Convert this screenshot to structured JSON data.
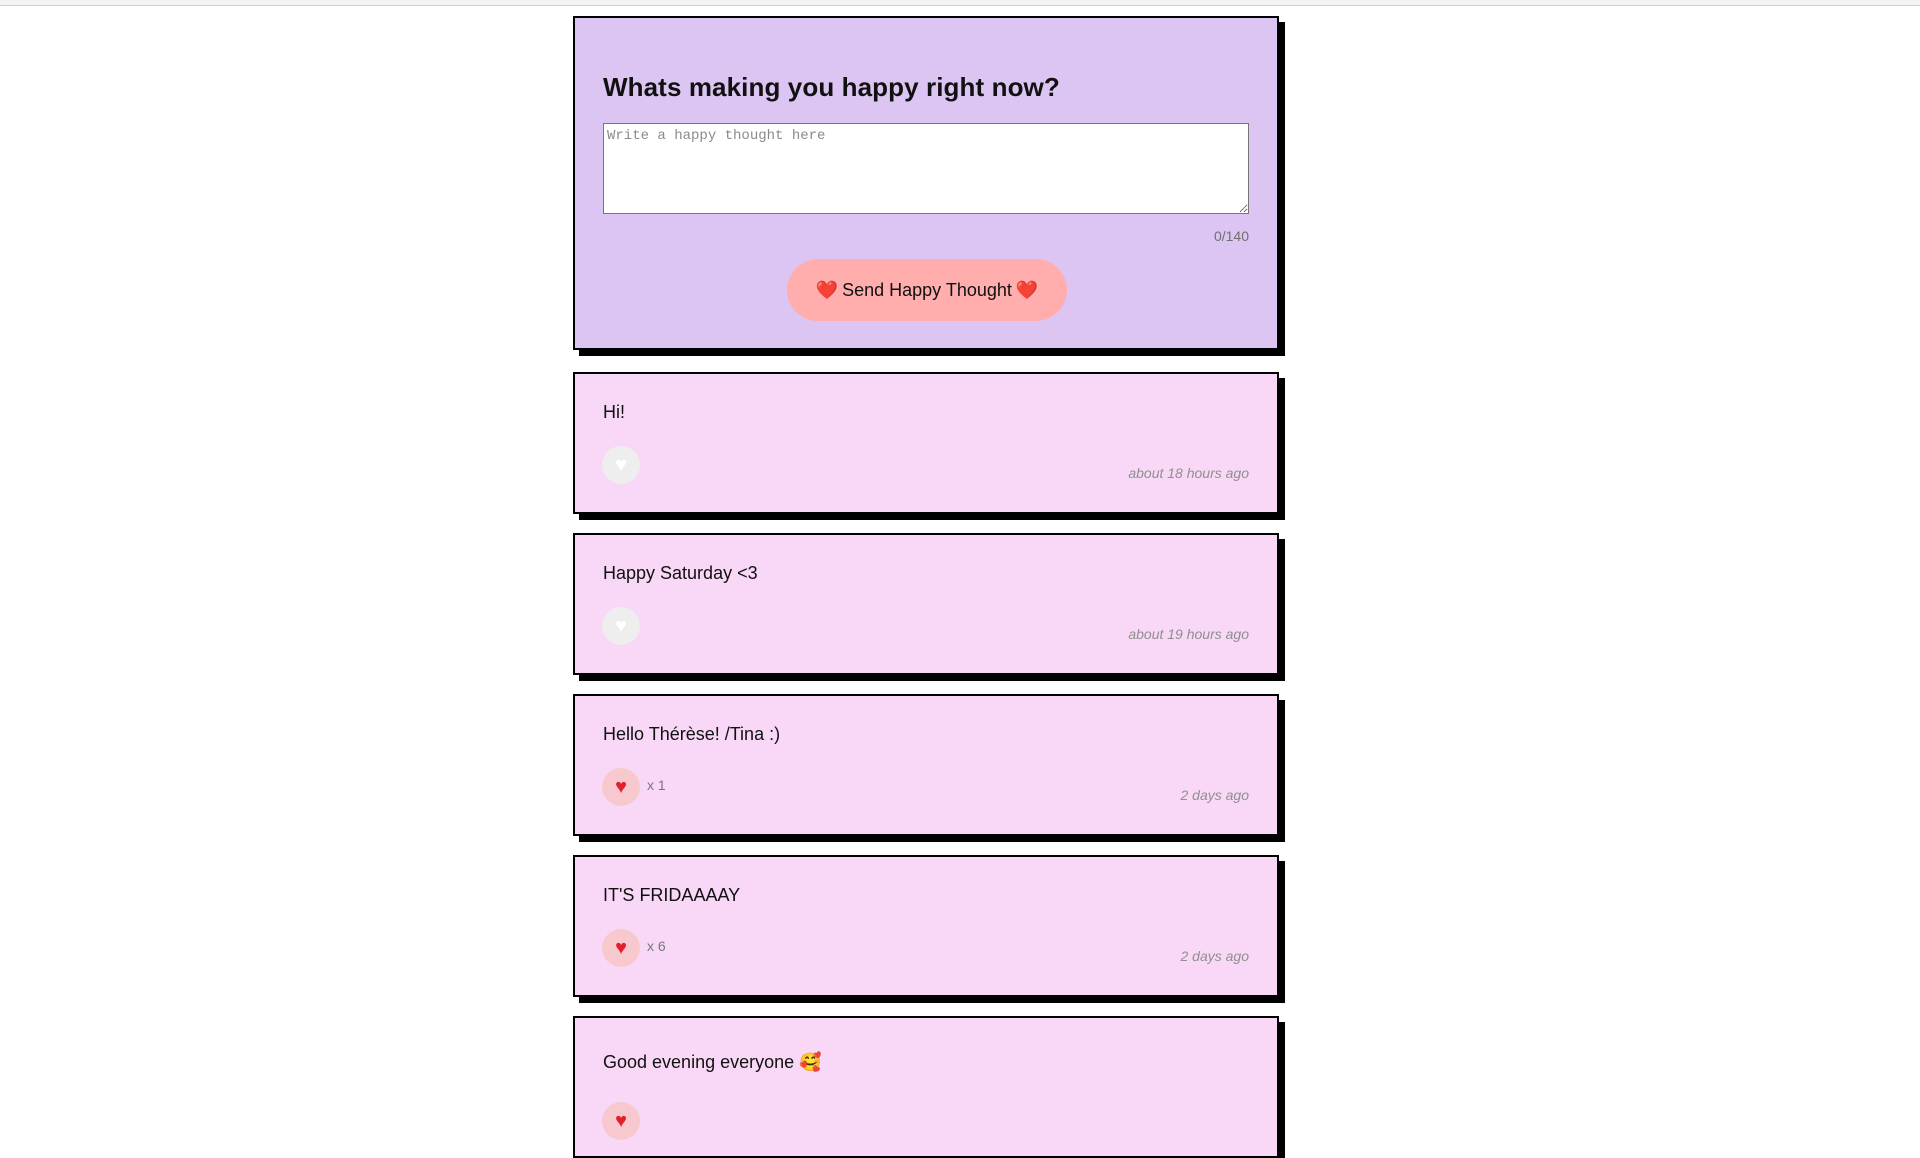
{
  "form": {
    "title": "Whats making you happy right now?",
    "placeholder": "Write a happy thought here",
    "value": "",
    "char_count": "0/140",
    "send_label": "Send Happy Thought",
    "heart_left": "❤️",
    "heart_right": "❤️"
  },
  "thoughts": [
    {
      "message": "Hi!",
      "likes": "",
      "liked": false,
      "time": "about 18 hours ago"
    },
    {
      "message": "Happy Saturday <3",
      "likes": "",
      "liked": false,
      "time": "about 19 hours ago"
    },
    {
      "message": "Hello Thérèse! /Tina :)",
      "likes": "x 1",
      "liked": true,
      "time": "2 days ago"
    },
    {
      "message": "IT'S FRIDAAAAY",
      "likes": "x 6",
      "liked": true,
      "time": "2 days ago"
    },
    {
      "message": "Good evening everyone 🥰",
      "likes": "",
      "liked": true,
      "time": ""
    }
  ],
  "icons": {
    "heart": "heart-icon"
  },
  "colors": {
    "form_bg": "#dcc5f3",
    "card_bg": "#f8d8f6",
    "button_bg": "#ffadad",
    "heart": "#e2202d"
  }
}
